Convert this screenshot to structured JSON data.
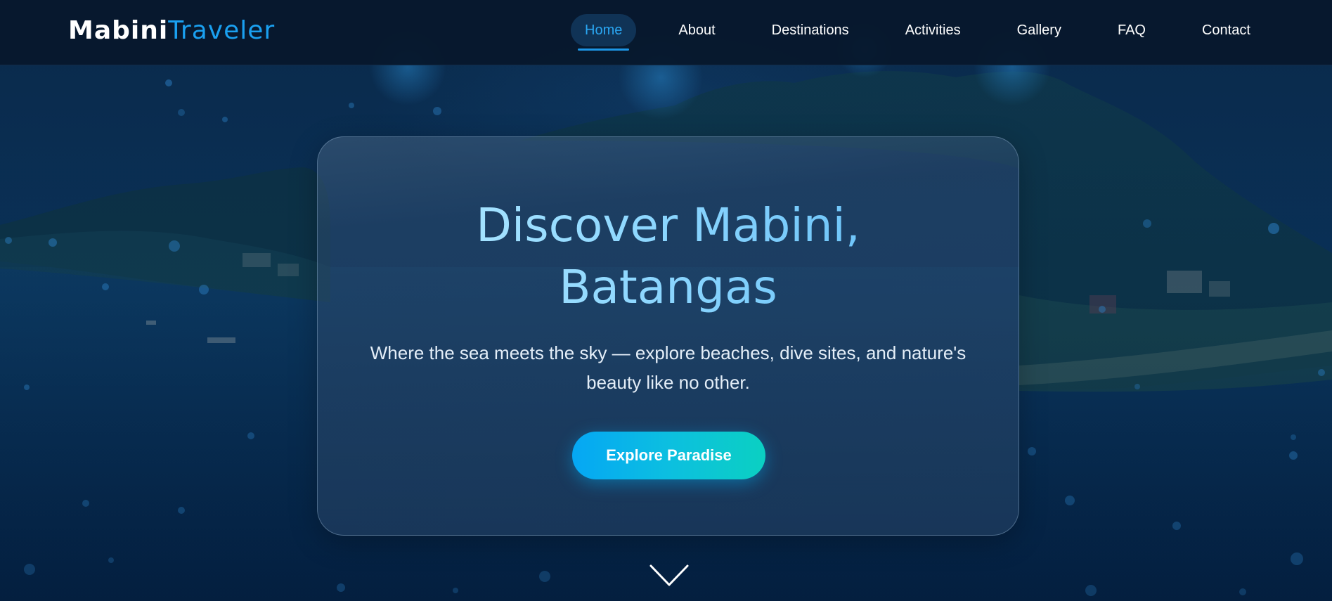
{
  "brand": {
    "part1": "Mabini",
    "part2": "Traveler"
  },
  "nav": {
    "items": [
      {
        "label": "Home",
        "active": true
      },
      {
        "label": "About"
      },
      {
        "label": "Destinations"
      },
      {
        "label": "Activities"
      },
      {
        "label": "Gallery"
      },
      {
        "label": "FAQ"
      },
      {
        "label": "Contact"
      }
    ]
  },
  "hero": {
    "title_line1": "Discover Mabini,",
    "title_line2": "Batangas",
    "subtitle": "Where the sea meets the sky — explore beaches, dive sites, and nature's beauty like no other.",
    "cta_label": "Explore Paradise",
    "scroll_icon": "chevron-down-icon"
  },
  "colors": {
    "accent": "#1aa0f0",
    "cta_start": "#05a7f4",
    "cta_end": "#0bd0c2",
    "nav_bg": "#07182d"
  }
}
